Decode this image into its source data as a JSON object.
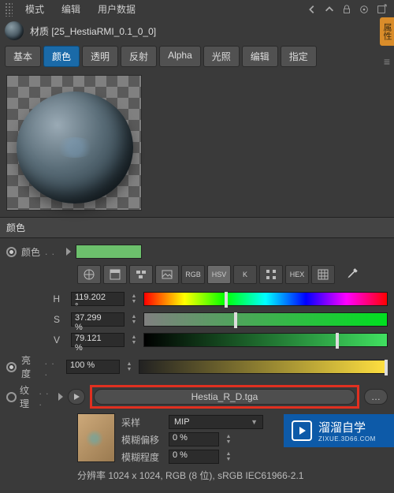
{
  "menu": {
    "mode": "模式",
    "edit": "编辑",
    "userdata": "用户数据"
  },
  "title": "材质 [25_HestiaRMI_0.1_0_0]",
  "side_tab": "属性",
  "tabs": {
    "basic": "基本",
    "color": "颜色",
    "transparency": "透明",
    "reflection": "反射",
    "alpha": "Alpha",
    "glow": "光照",
    "edit": "编辑",
    "assign": "指定"
  },
  "section_color": "颜色",
  "labels": {
    "color": "颜色",
    "brightness": "亮度",
    "texture": "纹理",
    "sampling": "采样",
    "blur_offset": "模糊偏移",
    "blur_scale": "模糊程度"
  },
  "mode_icons": {
    "rgb": "RGB",
    "hsv": "HSV",
    "k": "K",
    "hex": "HEX"
  },
  "hsv": {
    "h_label": "H",
    "h_value": "119.202 °",
    "s_label": "S",
    "s_value": "37.299 %",
    "v_label": "V",
    "v_value": "79.121 %"
  },
  "brightness_value": "100 %",
  "texture_file": "Hestia_R_D.tga",
  "sampling_value": "MIP",
  "blur_offset_value": "0 %",
  "blur_scale_value": "0 %",
  "status_line": "分辨率 1024 x 1024, RGB (8 位), sRGB IEC61966-2.1",
  "watermark": {
    "brand": "溜溜自学",
    "url": "ZIXUE.3D66.COM"
  },
  "colors": {
    "swatch": "#6cc06c",
    "accent": "#1a6aa8",
    "highlight_border": "#e03020"
  }
}
